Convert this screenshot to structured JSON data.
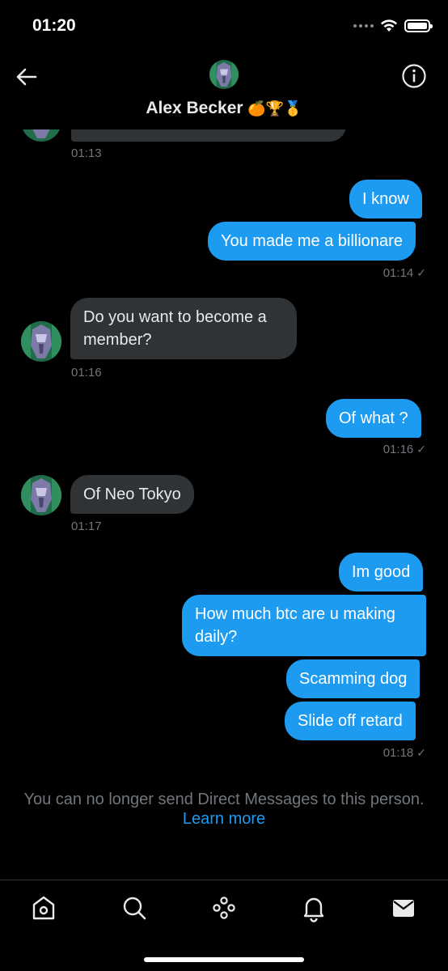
{
  "status_bar": {
    "time": "01:20"
  },
  "header": {
    "name": "Alex Becker",
    "emojis": "🍊🏆🥇"
  },
  "messages": [
    {
      "side": "in",
      "text": "",
      "time": "01:13"
    },
    {
      "side": "out",
      "text": "I know"
    },
    {
      "side": "out",
      "text": "You made me a billionare",
      "time": "01:14",
      "status": "✓"
    },
    {
      "side": "in",
      "text": "Do you want to become a member?",
      "time": "01:16"
    },
    {
      "side": "out",
      "text": "Of what ?",
      "time": "01:16",
      "status": "✓"
    },
    {
      "side": "in",
      "text": "Of Neo Tokyo",
      "time": "01:17"
    },
    {
      "side": "out",
      "text": "Im good"
    },
    {
      "side": "out",
      "text": "How much btc are u making daily?"
    },
    {
      "side": "out",
      "text": "Scamming dog"
    },
    {
      "side": "out",
      "text": "Slide off retard",
      "time": "01:18",
      "status": "✓"
    }
  ],
  "notice": {
    "text": "You can no longer send Direct Messages to this person.",
    "link": "Learn more"
  },
  "colors": {
    "accent": "#1d9bf0",
    "incoming_bubble": "#2f3336",
    "muted": "#71767b"
  },
  "tabs": [
    "home-icon",
    "search-icon",
    "spaces-icon",
    "notifications-icon",
    "messages-icon"
  ]
}
